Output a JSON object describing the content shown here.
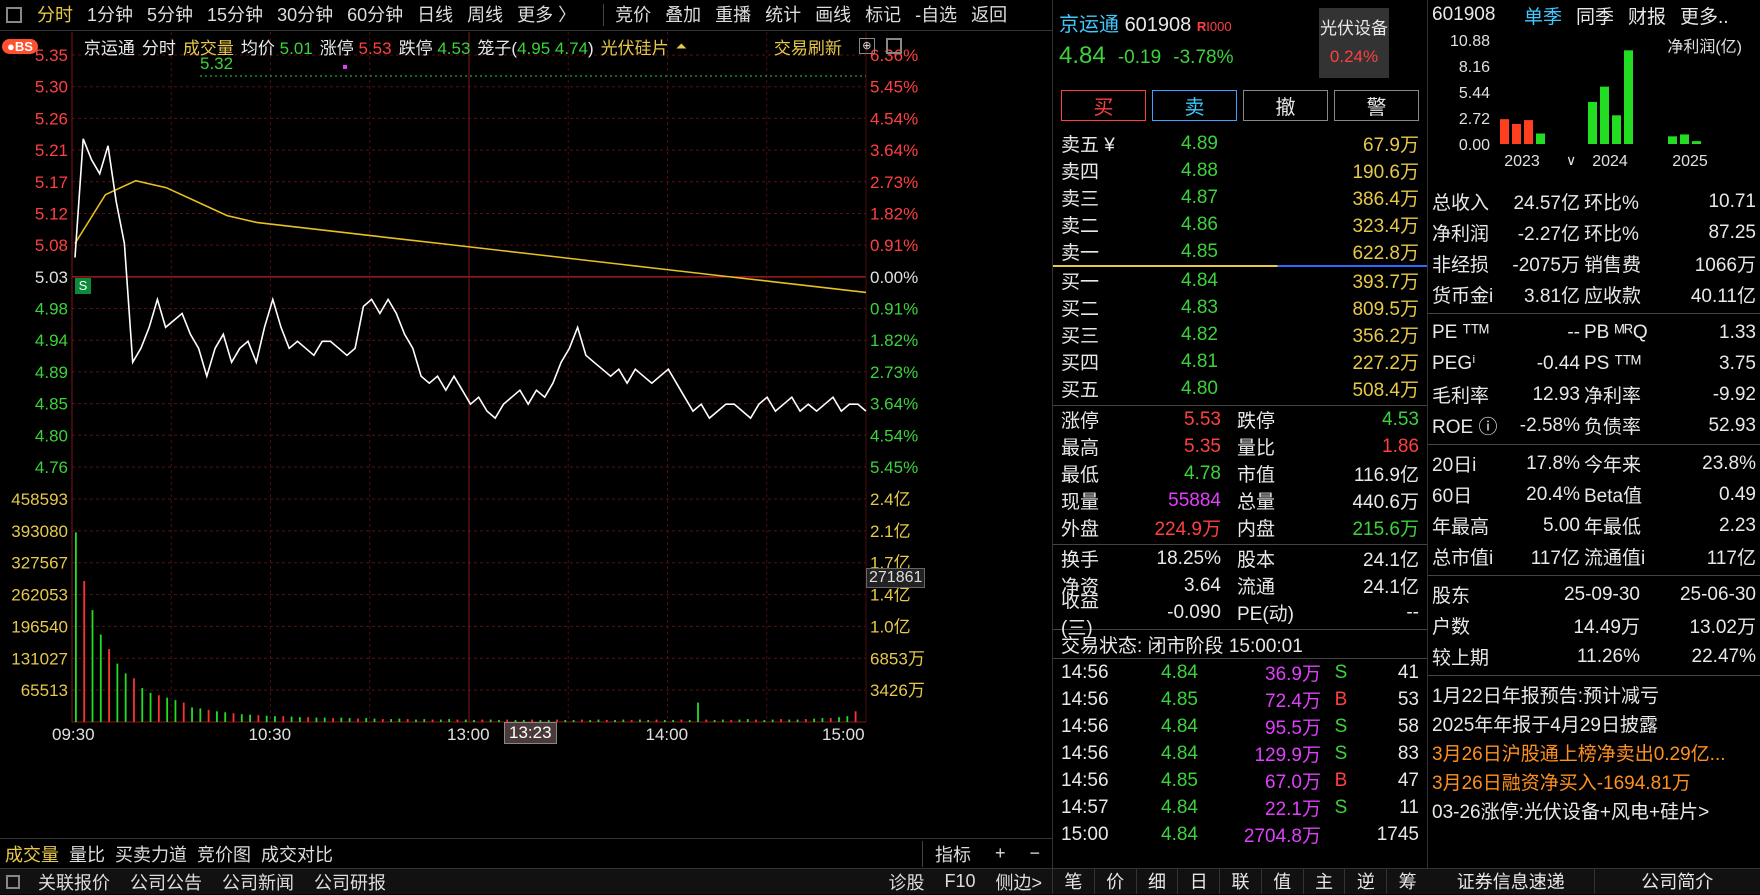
{
  "toolbar": {
    "periods": [
      "分时",
      "1分钟",
      "5分钟",
      "15分钟",
      "30分钟",
      "60分钟",
      "日线",
      "周线",
      "更多 〉"
    ],
    "active_period": "分时",
    "tools": [
      "竞价",
      "叠加",
      "重播",
      "统计",
      "画线",
      "标记",
      "-自选",
      "返回"
    ]
  },
  "chart_info": {
    "bs_badge": "BS",
    "name": "京运通",
    "mode": "分时",
    "vol_label": "成交量",
    "avg_label": "均价",
    "avg_value": "5.01",
    "limit_up_label": "涨停",
    "limit_up_value": "5.53",
    "limit_down_label": "跌停",
    "limit_down_value": "4.53",
    "cage_label": "笼子(",
    "cage_high": "4.95",
    "cage_low": "4.74",
    "cage_close": ")",
    "sector": "光伏硅片",
    "refresh": "交易刷新",
    "max_marker": "5.32",
    "s_marker": "S",
    "cursor_time": "13:23",
    "vol_cursor": "271861"
  },
  "chart_data": {
    "type": "line",
    "title": "京运通 分时",
    "price_ticks": [
      "5.35",
      "5.30",
      "5.26",
      "5.21",
      "5.17",
      "5.12",
      "5.08",
      "5.03",
      "4.98",
      "4.94",
      "4.89",
      "4.85",
      "4.80",
      "4.76"
    ],
    "pct_ticks": [
      "6.36%",
      "5.45%",
      "4.54%",
      "3.64%",
      "2.73%",
      "1.82%",
      "0.91%",
      "0.00%",
      "0.91%",
      "1.82%",
      "2.73%",
      "3.64%",
      "4.54%",
      "5.45%"
    ],
    "vol_ticks": [
      "458593",
      "393080",
      "327567",
      "262053",
      "196540",
      "131027",
      "65513"
    ],
    "amount_ticks": [
      "2.4亿",
      "2.1亿",
      "1.7亿",
      "1.4亿",
      "1.0亿",
      "6853万",
      "3426万"
    ],
    "time_ticks": [
      "09:30",
      "10:30",
      "13:00",
      "14:00",
      "15:00"
    ],
    "ylim": [
      4.76,
      5.35
    ],
    "prev_close": 5.03,
    "price_series": [
      5.06,
      5.23,
      5.2,
      5.18,
      5.22,
      5.14,
      5.08,
      4.91,
      4.93,
      4.96,
      5.0,
      4.96,
      4.97,
      4.98,
      4.95,
      4.93,
      4.89,
      4.93,
      4.95,
      4.91,
      4.93,
      4.94,
      4.91,
      4.96,
      5.0,
      4.96,
      4.93,
      4.94,
      4.93,
      4.92,
      4.94,
      4.94,
      4.93,
      4.92,
      4.93,
      4.99,
      5.0,
      4.98,
      5.0,
      4.98,
      4.95,
      4.93,
      4.89,
      4.88,
      4.89,
      4.87,
      4.89,
      4.87,
      4.85,
      4.86,
      4.84,
      4.83,
      4.85,
      4.86,
      4.87,
      4.85,
      4.87,
      4.86,
      4.88,
      4.91,
      4.93,
      4.96,
      4.92,
      4.91,
      4.9,
      4.89,
      4.9,
      4.88,
      4.9,
      4.89,
      4.88,
      4.89,
      4.9,
      4.88,
      4.86,
      4.84,
      4.85,
      4.83,
      4.84,
      4.85,
      4.85,
      4.84,
      4.83,
      4.85,
      4.86,
      4.84,
      4.85,
      4.86,
      4.84,
      4.85,
      4.84,
      4.85,
      4.86,
      4.84,
      4.85,
      4.85,
      4.84
    ],
    "avg_series": [
      5.08,
      5.15,
      5.17,
      5.16,
      5.14,
      5.12,
      5.11,
      5.105,
      5.1,
      5.095,
      5.09,
      5.085,
      5.08,
      5.075,
      5.07,
      5.065,
      5.06,
      5.055,
      5.05,
      5.045,
      5.04,
      5.035,
      5.03,
      5.025,
      5.02,
      5.015,
      5.01
    ],
    "volume_bars": [
      390000,
      290000,
      230000,
      180000,
      150000,
      120000,
      100000,
      90000,
      70000,
      60000,
      55000,
      50000,
      45000,
      40000,
      30000,
      28000,
      25000,
      22000,
      20000,
      18000,
      16000,
      15000,
      14000,
      13000,
      12000,
      12000,
      11000,
      10000,
      10000,
      9000,
      9000,
      8000,
      9000,
      8000,
      7000,
      8000,
      7000,
      6000,
      6000,
      7000,
      6000,
      5000,
      6000,
      5000,
      5000,
      6000,
      5000,
      5000,
      4000,
      5000,
      5000,
      4000,
      5000,
      4000,
      4000,
      5000,
      4000,
      4000,
      5000,
      4000,
      4000,
      5000,
      4000,
      5000,
      4000,
      4000,
      5000,
      4000,
      5000,
      4000,
      5000,
      4000,
      4000,
      5000,
      4000,
      40000,
      5000,
      4000,
      5000,
      4000,
      5000,
      6000,
      5000,
      4000,
      5000,
      6000,
      5000,
      5000,
      6000,
      7000,
      8000,
      8000,
      10000,
      12000,
      22000
    ]
  },
  "bottom_tabs": [
    "成交量",
    "量比",
    "买卖力道",
    "竞价图",
    "成交对比"
  ],
  "bottom_right": [
    "指标",
    "+",
    "−"
  ],
  "status_bar": {
    "items": [
      "关联报价",
      "公司公告",
      "公司新闻",
      "公司研报"
    ],
    "right": [
      "诊股",
      "F10",
      "侧边>"
    ]
  },
  "quote": {
    "name": "京运通",
    "code": "601908",
    "badge": "R",
    "badge_sub": "I000",
    "price": "4.84",
    "change": "-0.19",
    "change_pct": "-3.78%",
    "sector_name": "光伏设备",
    "sector_pct": "0.24%",
    "actions": [
      "买",
      "卖",
      "撤",
      "警"
    ],
    "asks": [
      {
        "label": "卖五 ¥",
        "price": "4.89",
        "vol": "67.9万"
      },
      {
        "label": "卖四",
        "price": "4.88",
        "vol": "190.6万"
      },
      {
        "label": "卖三",
        "price": "4.87",
        "vol": "386.4万"
      },
      {
        "label": "卖二",
        "price": "4.86",
        "vol": "323.4万"
      },
      {
        "label": "卖一",
        "price": "4.85",
        "vol": "622.8万"
      }
    ],
    "bids": [
      {
        "label": "买一",
        "price": "4.84",
        "vol": "393.7万"
      },
      {
        "label": "买二",
        "price": "4.83",
        "vol": "809.5万"
      },
      {
        "label": "买三",
        "price": "4.82",
        "vol": "356.2万"
      },
      {
        "label": "买四",
        "price": "4.81",
        "vol": "227.2万"
      },
      {
        "label": "买五",
        "price": "4.80",
        "vol": "508.4万"
      }
    ],
    "stats": [
      {
        "l1": "涨停",
        "v1": "5.53",
        "l2": "跌停",
        "v2": "4.53"
      },
      {
        "l1": "最高",
        "v1": "5.35",
        "l2": "量比",
        "v2": "1.86"
      },
      {
        "l1": "最低",
        "v1": "4.78",
        "l2": "市值",
        "v2": "116.9亿"
      },
      {
        "l1": "现量",
        "v1": "55884",
        "l2": "总量",
        "v2": "440.6万"
      },
      {
        "l1": "外盘",
        "v1": "224.9万",
        "l2": "内盘",
        "v2": "215.6万"
      }
    ],
    "stats2": [
      {
        "l1": "换手",
        "v1": "18.25%",
        "l2": "股本",
        "v2": "24.1亿"
      },
      {
        "l1": "净资",
        "v1": "3.64",
        "l2": "流通",
        "v2": "24.1亿"
      },
      {
        "l1": "收益(三)",
        "v1": "-0.090",
        "l2": "PE(动)",
        "v2": "--"
      }
    ],
    "trade_status": "交易状态: 闭市阶段 15:00:01",
    "ticks": [
      {
        "t": "14:56",
        "p": "4.84",
        "v": "36.9万",
        "s": "S",
        "n": "41"
      },
      {
        "t": "14:56",
        "p": "4.85",
        "v": "72.4万",
        "s": "B",
        "n": "53"
      },
      {
        "t": "14:56",
        "p": "4.84",
        "v": "95.5万",
        "s": "S",
        "n": "58"
      },
      {
        "t": "14:56",
        "p": "4.84",
        "v": "129.9万",
        "s": "S",
        "n": "83"
      },
      {
        "t": "14:56",
        "p": "4.85",
        "v": "67.0万",
        "s": "B",
        "n": "47"
      },
      {
        "t": "14:57",
        "p": "4.84",
        "v": "22.1万",
        "s": "S",
        "n": "11"
      },
      {
        "t": "15:00",
        "p": "4.84",
        "v": "2704.8万",
        "s": "",
        "n": "1745"
      }
    ],
    "bottom_tabs": [
      "笔",
      "价",
      "细",
      "日",
      "联",
      "值",
      "主",
      "逆",
      "筹"
    ]
  },
  "fin": {
    "code": "601908",
    "tabs": [
      "单季",
      "同季",
      "财报",
      "更多.."
    ],
    "y_ticks": [
      "10.88",
      "8.16",
      "5.44",
      "2.72",
      "0.00"
    ],
    "chart_title": "净利润(亿)",
    "years": [
      "2023",
      "2024",
      "2025"
    ],
    "bars": [
      {
        "v": 2.6,
        "c": "#ff4020"
      },
      {
        "v": 2.1,
        "c": "#ff4020"
      },
      {
        "v": 2.5,
        "c": "#ff4020"
      },
      {
        "v": 1.1,
        "c": "#22dd22"
      },
      {
        "v": 4.4,
        "c": "#22dd22"
      },
      {
        "v": 6.0,
        "c": "#22dd22"
      },
      {
        "v": 3.0,
        "c": "#22dd22"
      },
      {
        "v": 9.8,
        "c": "#22dd22"
      },
      {
        "v": 0.8,
        "c": "#22dd22"
      },
      {
        "v": 1.0,
        "c": "#22dd22"
      },
      {
        "v": 0.3,
        "c": "#22dd22"
      }
    ],
    "rows": [
      {
        "l1": "总收入",
        "v1": "24.57亿",
        "l2": "环比%",
        "v2": "10.71"
      },
      {
        "l1": "净利润",
        "v1": "-2.27亿",
        "l2": "环比%",
        "v2": "87.25"
      },
      {
        "l1": "非经损",
        "v1": "-2075万",
        "l2": "销售费",
        "v2": "1066万"
      },
      {
        "l1": "货币金i",
        "v1": "3.81亿",
        "l2": "应收款",
        "v2": "40.11亿"
      }
    ],
    "rows2": [
      {
        "l1": "PE ᵀᵀᴹ",
        "v1": "--",
        "l2": "PB ᴹᴿQ",
        "v2": "1.33"
      },
      {
        "l1": "PEGⁱ",
        "v1": "-0.44",
        "l2": "PS ᵀᵀᴹ",
        "v2": "3.75"
      },
      {
        "l1": "毛利率",
        "v1": "12.93",
        "l2": "净利率",
        "v2": "-9.92"
      },
      {
        "l1": "ROE ⓘ",
        "v1": "-2.58%",
        "l2": "负债率",
        "v2": "52.93"
      }
    ],
    "rows3": [
      {
        "l1": "20日i",
        "v1": "17.8%",
        "l2": "今年来",
        "v2": "23.8%"
      },
      {
        "l1": "60日",
        "v1": "20.4%",
        "l2": "Beta值",
        "v2": "0.49"
      },
      {
        "l1": "年最高",
        "v1": "5.00",
        "l2": "年最低",
        "v2": "2.23"
      },
      {
        "l1": "总市值i",
        "v1": "117亿",
        "l2": "流通值i",
        "v2": "117亿"
      }
    ],
    "holders_head": {
      "l": "股东",
      "a": "25-09-30",
      "b": "25-06-30"
    },
    "holders": [
      {
        "l": "户数",
        "a": "14.49万",
        "b": "13.02万"
      },
      {
        "l": "较上期",
        "a": "11.26%",
        "b": "22.47%"
      }
    ],
    "news": [
      {
        "text": "1月22日年报预告:预计减亏",
        "color": "#e8e8e8"
      },
      {
        "text": "2025年年报于4月29日披露",
        "color": "#e8e8e8"
      },
      {
        "text": "3月26日沪股通上榜净卖出0.29亿...",
        "color": "#ff9020"
      },
      {
        "text": "3月26日融资净买入-1694.81万",
        "color": "#ff9020"
      },
      {
        "text": "03-26涨停:光伏设备+风电+硅片>",
        "color": "#e8e8e8"
      }
    ],
    "bottom_tabs": [
      "证券信息速递",
      "公司简介"
    ]
  }
}
